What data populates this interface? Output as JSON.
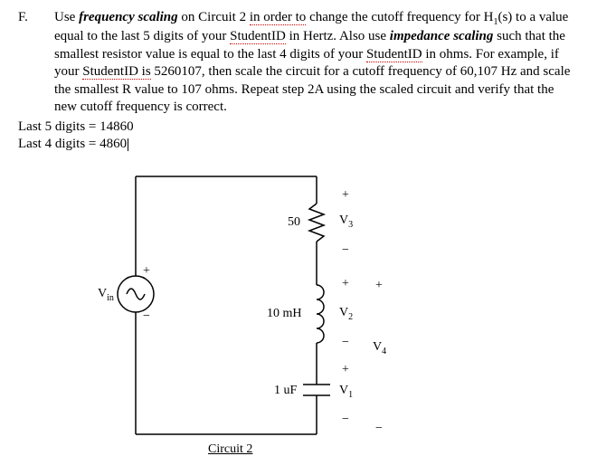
{
  "problem": {
    "letter": "F.",
    "text_parts": {
      "p1a": "Use ",
      "p1b": "frequency scaling",
      "p1c": " on Circuit 2 ",
      "p1d": "in order to",
      "p1e": " change the cutoff frequency for H",
      "p1f": "1",
      "p1g": "(s) to a value equal to the last 5 digits of your ",
      "p1h": "StudentID",
      "p1i": " in Hertz.  Also use ",
      "p1j": "impedance scaling",
      "p1k": " such that the smallest resistor value is equal to the last 4 digits of your ",
      "p1l": "StudentID",
      "p1m": " in ohms.  For example, if your ",
      "p1n": "StudentID is",
      "p1o": " 5260107, then scale the circuit for a cutoff frequency of 60,107 Hz and scale the smallest R value to 107 ohms.  Repeat step 2A using the scaled circuit and verify that the new cutoff frequency is correct."
    }
  },
  "notes": {
    "line1": "Last 5 digits = 14860",
    "line2": "Last 4 digits = 4860"
  },
  "circuit": {
    "vin_label": "V",
    "vin_sub": "in",
    "r_label": "50",
    "l_label": "10 mH",
    "c_label": "1 uF",
    "v1": "V",
    "v1s": "1",
    "v2": "V",
    "v2s": "2",
    "v3": "V",
    "v3s": "3",
    "v4": "V",
    "v4s": "4",
    "plus": "+",
    "minus": "−",
    "caption": "Circuit 2"
  }
}
